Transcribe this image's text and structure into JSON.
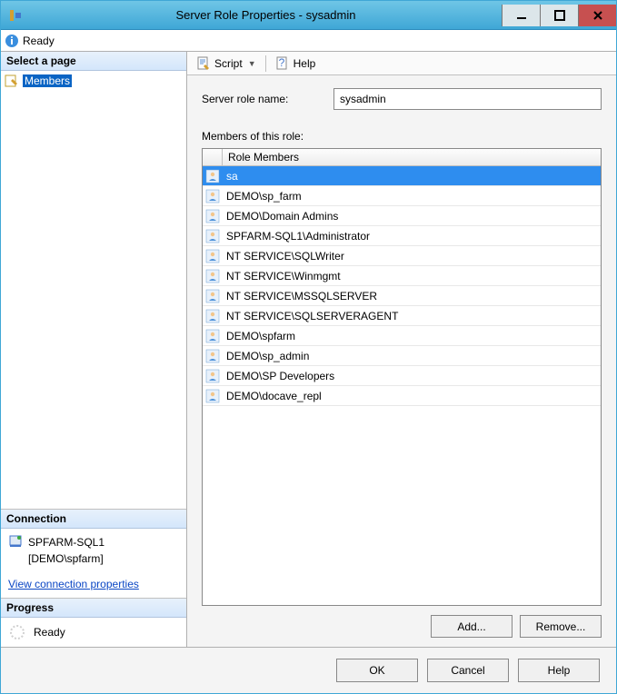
{
  "window": {
    "title": "Server Role Properties - sysadmin"
  },
  "status": {
    "text": "Ready"
  },
  "left": {
    "select_page": "Select a page",
    "pages": [
      {
        "label": "Members",
        "selected": true
      }
    ],
    "connection": {
      "header": "Connection",
      "server": "SPFARM-SQL1",
      "user": "[DEMO\\spfarm]",
      "view_link": "View connection properties"
    },
    "progress": {
      "header": "Progress",
      "text": "Ready"
    }
  },
  "toolbar": {
    "script": "Script",
    "help": "Help"
  },
  "form": {
    "role_name_label": "Server role name:",
    "role_name_value": "sysadmin",
    "members_label": "Members of this role:",
    "column_header": "Role Members",
    "members": [
      {
        "name": "sa",
        "selected": true
      },
      {
        "name": "DEMO\\sp_farm"
      },
      {
        "name": "DEMO\\Domain Admins"
      },
      {
        "name": "SPFARM-SQL1\\Administrator"
      },
      {
        "name": "NT SERVICE\\SQLWriter"
      },
      {
        "name": "NT SERVICE\\Winmgmt"
      },
      {
        "name": "NT SERVICE\\MSSQLSERVER"
      },
      {
        "name": "NT SERVICE\\SQLSERVERAGENT"
      },
      {
        "name": "DEMO\\spfarm"
      },
      {
        "name": "DEMO\\sp_admin"
      },
      {
        "name": "DEMO\\SP Developers"
      },
      {
        "name": "DEMO\\docave_repl"
      }
    ],
    "add_button": "Add...",
    "remove_button": "Remove..."
  },
  "buttons": {
    "ok": "OK",
    "cancel": "Cancel",
    "help": "Help"
  }
}
